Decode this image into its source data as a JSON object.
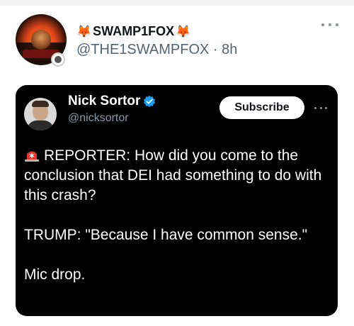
{
  "post": {
    "display_name": "SWAMP1FOX",
    "handle_line": "@THE1SWAMPFOX · 8h"
  },
  "embed": {
    "name": "Nick Sortor",
    "handle": "@nicksortor",
    "subscribe_label": "Subscribe",
    "line1": "REPORTER: How did you come to the conclusion that DEI had something to do with this crash?",
    "line2": "TRUMP: \"Because I have common sense.\"",
    "line3": "Mic drop."
  },
  "icons": {
    "fox": "fox-emoji",
    "alarm": "rotating-light-emoji",
    "verified": "verified-check-blue",
    "more": "more-horizontal"
  },
  "colors": {
    "verified_blue": "#1d9bf0",
    "alarm_red": "#e0342c"
  }
}
